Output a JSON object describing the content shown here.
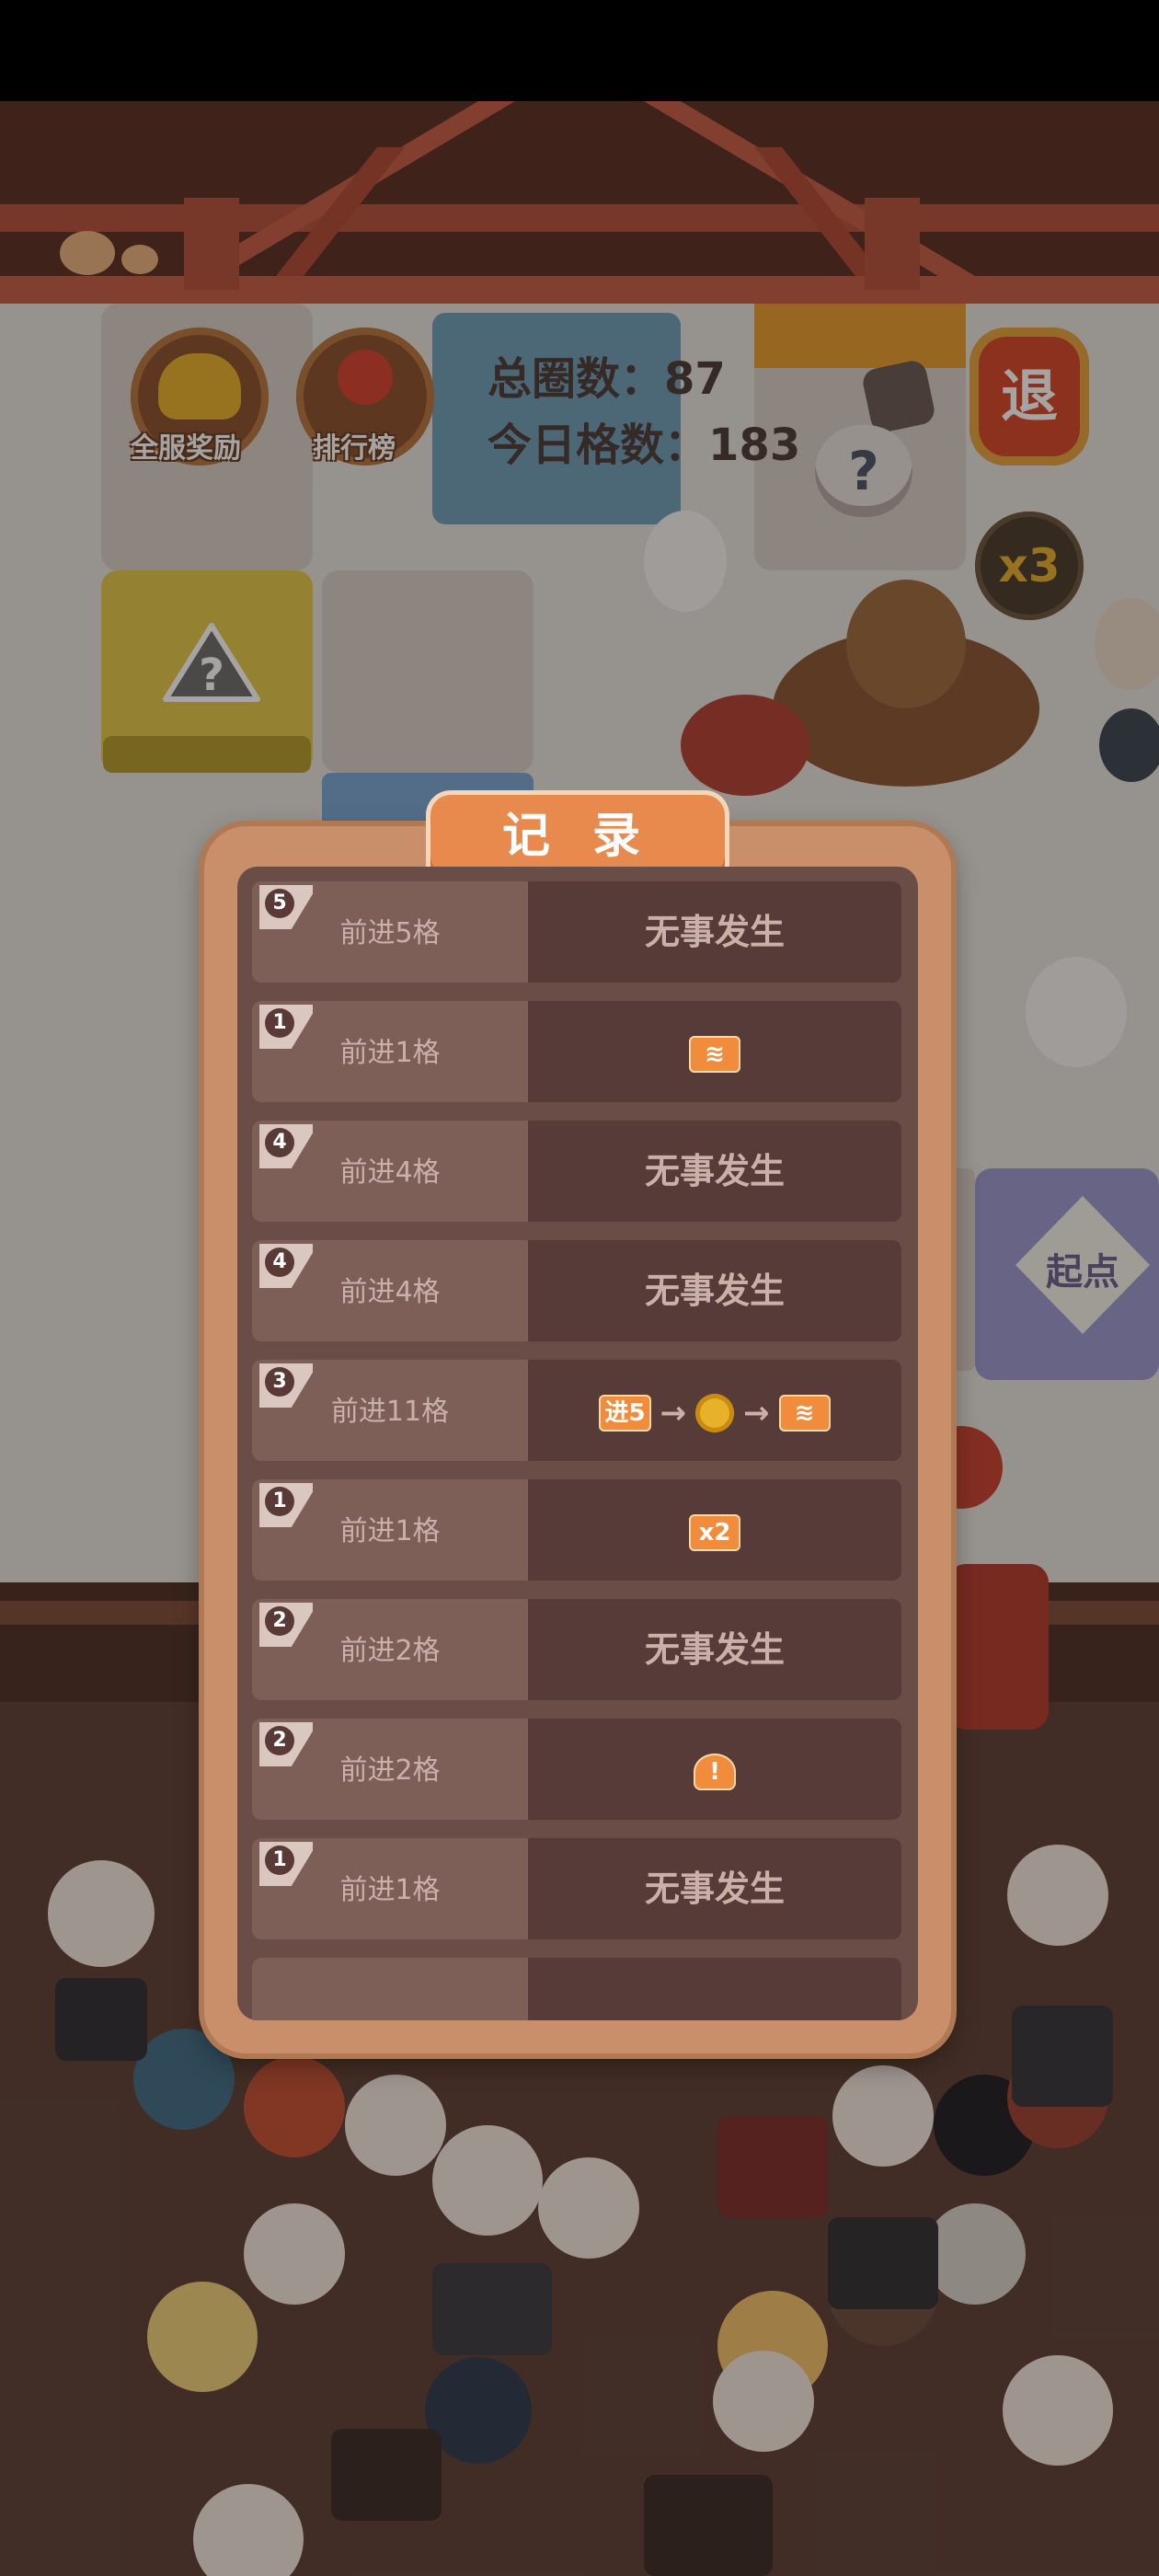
{
  "hud": {
    "total_laps_label": "总圈数：",
    "total_laps_value": "87",
    "today_cells_label": "今日格数：",
    "today_cells_value": "183",
    "server_reward_label": "全服奖励",
    "ranking_label": "排行榜",
    "exit_label": "退",
    "multiplier_label": "x3",
    "start_label": "起点",
    "question_mark": "?"
  },
  "dialog": {
    "title": "记 录",
    "rows": [
      {
        "dice": "5",
        "step": "前进5格",
        "event_text": "无事发生",
        "icons": []
      },
      {
        "dice": "1",
        "step": "前进1格",
        "event_text": "",
        "icons": [
          "wave-tile-icon"
        ]
      },
      {
        "dice": "4",
        "step": "前进4格",
        "event_text": "无事发生",
        "icons": []
      },
      {
        "dice": "4",
        "step": "前进4格",
        "event_text": "无事发生",
        "icons": []
      },
      {
        "dice": "3",
        "step": "前进11格",
        "event_text": "",
        "icons": [
          "advance-tile-icon",
          "coin-icon",
          "wave-tile-icon"
        ],
        "advance_label": "进5"
      },
      {
        "dice": "1",
        "step": "前进1格",
        "event_text": "",
        "icons": [
          "multiplier-tile-icon"
        ],
        "multiplier_label": "x2"
      },
      {
        "dice": "2",
        "step": "前进2格",
        "event_text": "无事发生",
        "icons": []
      },
      {
        "dice": "2",
        "step": "前进2格",
        "event_text": "",
        "icons": [
          "warning-icon"
        ]
      },
      {
        "dice": "1",
        "step": "前进1格",
        "event_text": "无事发生",
        "icons": []
      }
    ]
  },
  "colors": {
    "dialog_frame": "#c98e6a",
    "dialog_inner": "#6b4d48",
    "title_bg": "#e8894e",
    "row_left": "#7e5f58",
    "row_right": "#563b38",
    "event_icon": "#f08c3c"
  }
}
